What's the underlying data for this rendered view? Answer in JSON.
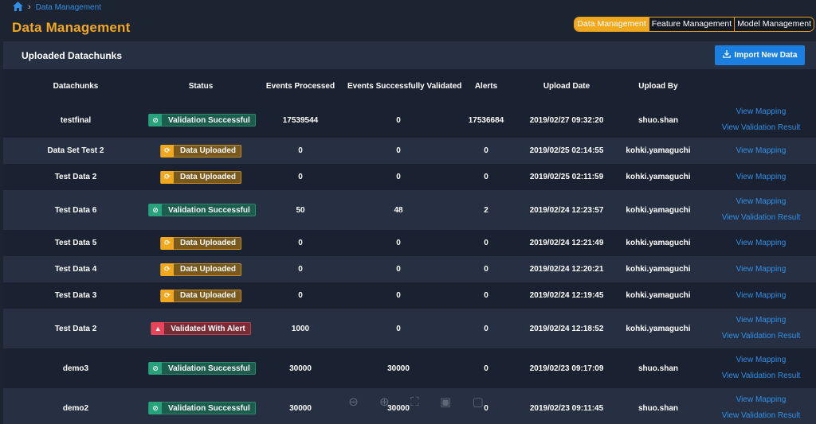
{
  "breadcrumb": {
    "current": "Data Management"
  },
  "page_title": "Data Management",
  "tabs": [
    {
      "label": "Data Management",
      "active": true
    },
    {
      "label": "Feature Management",
      "active": false
    },
    {
      "label": "Model Management",
      "active": false
    }
  ],
  "panel": {
    "title": "Uploaded Datachunks",
    "import_button": "Import New Data"
  },
  "table": {
    "headers": [
      "Datachunks",
      "Status",
      "Events Processed",
      "Events Successfully Validated",
      "Alerts",
      "Upload Date",
      "Upload By",
      ""
    ],
    "rows": [
      {
        "name": "testfinal",
        "status": "Validation Successful",
        "status_type": "success",
        "processed": "17539544",
        "validated": "0",
        "alerts": "17536684",
        "date": "2019/02/27 09:32:20",
        "by": "shuo.shan",
        "links": [
          "View Mapping",
          "View Validation Result"
        ]
      },
      {
        "name": "Data Set Test 2",
        "status": "Data Uploaded",
        "status_type": "uploaded",
        "processed": "0",
        "validated": "0",
        "alerts": "0",
        "date": "2019/02/25 02:14:55",
        "by": "kohki.yamaguchi",
        "links": [
          "View Mapping"
        ]
      },
      {
        "name": "Test Data 2",
        "status": "Data Uploaded",
        "status_type": "uploaded",
        "processed": "0",
        "validated": "0",
        "alerts": "0",
        "date": "2019/02/25 02:11:59",
        "by": "kohki.yamaguchi",
        "links": [
          "View Mapping"
        ]
      },
      {
        "name": "Test Data 6",
        "status": "Validation Successful",
        "status_type": "success",
        "processed": "50",
        "validated": "48",
        "alerts": "2",
        "date": "2019/02/24 12:23:57",
        "by": "kohki.yamaguchi",
        "links": [
          "View Mapping",
          "View Validation Result"
        ]
      },
      {
        "name": "Test Data 5",
        "status": "Data Uploaded",
        "status_type": "uploaded",
        "processed": "0",
        "validated": "0",
        "alerts": "0",
        "date": "2019/02/24 12:21:49",
        "by": "kohki.yamaguchi",
        "links": [
          "View Mapping"
        ]
      },
      {
        "name": "Test Data 4",
        "status": "Data Uploaded",
        "status_type": "uploaded",
        "processed": "0",
        "validated": "0",
        "alerts": "0",
        "date": "2019/02/24 12:20:21",
        "by": "kohki.yamaguchi",
        "links": [
          "View Mapping"
        ]
      },
      {
        "name": "Test Data 3",
        "status": "Data Uploaded",
        "status_type": "uploaded",
        "processed": "0",
        "validated": "0",
        "alerts": "0",
        "date": "2019/02/24 12:19:45",
        "by": "kohki.yamaguchi",
        "links": [
          "View Mapping"
        ]
      },
      {
        "name": "Test Data 2",
        "status": "Validated With Alert",
        "status_type": "alert",
        "processed": "1000",
        "validated": "0",
        "alerts": "0",
        "date": "2019/02/24 12:18:52",
        "by": "kohki.yamaguchi",
        "links": [
          "View Mapping",
          "View Validation Result"
        ]
      },
      {
        "name": "demo3",
        "status": "Validation Successful",
        "status_type": "success",
        "processed": "30000",
        "validated": "30000",
        "alerts": "0",
        "date": "2019/02/23 09:17:09",
        "by": "shuo.shan",
        "links": [
          "View Mapping",
          "View Validation Result"
        ]
      },
      {
        "name": "demo2",
        "status": "Validation Successful",
        "status_type": "success",
        "processed": "30000",
        "validated": "30000",
        "alerts": "0",
        "date": "2019/02/23 09:11:45",
        "by": "shuo.shan",
        "links": [
          "View Mapping",
          "View Validation Result"
        ]
      }
    ]
  },
  "icons": {
    "home": "home-icon",
    "chevron": "chevron-right-icon",
    "import": "download-icon",
    "success": "check-circle-icon",
    "uploaded": "refresh-icon",
    "alert": "warning-triangle-icon"
  },
  "colors": {
    "accent": "#f2a81d",
    "link": "#2f8fe6",
    "primary_button": "#1a7fe0",
    "success": "#27a37c",
    "warning": "#f2a81d",
    "danger": "#e8445a"
  }
}
